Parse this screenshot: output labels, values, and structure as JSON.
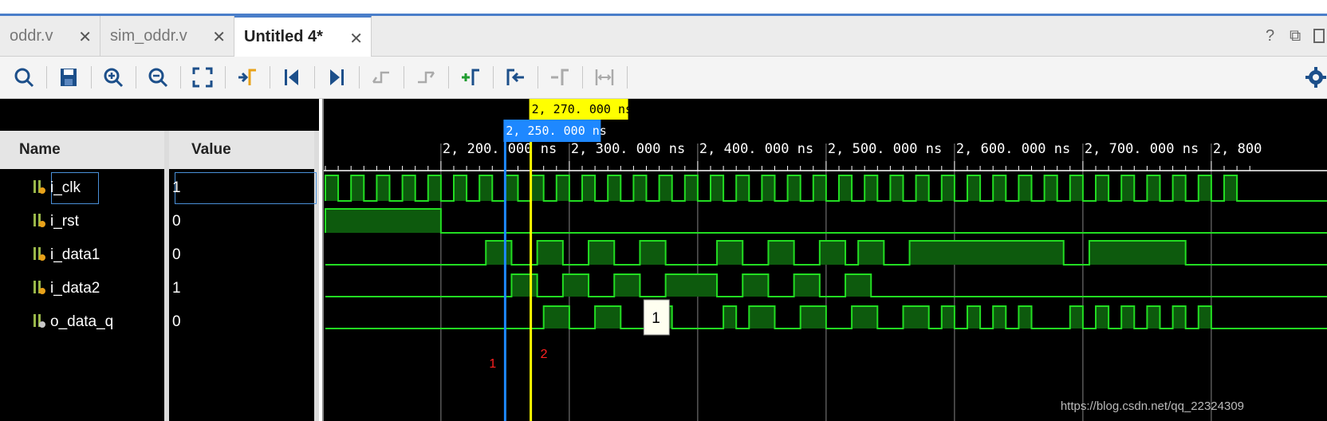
{
  "tabs": [
    {
      "label": "oddr.v",
      "active": false
    },
    {
      "label": "sim_oddr.v",
      "active": false
    },
    {
      "label": "Untitled 4*",
      "active": true
    }
  ],
  "window_controls": {
    "help": "?",
    "restore": "⧉"
  },
  "toolbar": {
    "icons": [
      "search-icon",
      "save-icon",
      "zoom-in-icon",
      "zoom-out-icon",
      "zoom-fit-icon",
      "goto-cursor-icon",
      "go-to-time-0-icon",
      "go-to-last-time-icon",
      "previous-transition-icon",
      "next-transition-icon",
      "add-marker-icon",
      "previous-marker-icon",
      "next-marker-icon",
      "swap-cursors-icon",
      "settings-icon"
    ]
  },
  "columns": {
    "name": "Name",
    "value": "Value"
  },
  "signals": [
    {
      "name": "i_clk",
      "value": "1",
      "type": "input"
    },
    {
      "name": "i_rst",
      "value": "0",
      "type": "input"
    },
    {
      "name": "i_data1",
      "value": "0",
      "type": "input"
    },
    {
      "name": "i_data2",
      "value": "1",
      "type": "input"
    },
    {
      "name": "o_data_q",
      "value": "0",
      "type": "output"
    }
  ],
  "ruler": {
    "ticks": [
      "2, 200. 000 ns",
      "2, 300. 000 ns",
      "2, 400. 000 ns",
      "2, 500. 000 ns",
      "2, 600. 000 ns",
      "2, 700. 000 ns",
      "2, 800"
    ],
    "tick_times": [
      2200,
      2300,
      2400,
      2500,
      2600,
      2700,
      2800
    ]
  },
  "cursors": {
    "main": {
      "label": "2, 270. 000 ns",
      "time": 2270,
      "color": "#ffff00"
    },
    "secondary": {
      "label": "2, 250. 000 ns",
      "time": 2250,
      "color": "#1e88ff"
    }
  },
  "markers": [
    {
      "label": "1",
      "time": 2250,
      "color": "#ff2020"
    },
    {
      "label": "2",
      "time": 2270,
      "color": "#ff2020"
    }
  ],
  "tooltip": {
    "text": "1"
  },
  "waves": {
    "clk_period_ns": 20,
    "visible_start_ns": 2110,
    "i_rst_high_until_ns": 2200,
    "i_data1_high": [
      [
        2235,
        2255
      ],
      [
        2275,
        2295
      ],
      [
        2315,
        2335
      ],
      [
        2355,
        2375
      ],
      [
        2415,
        2435
      ],
      [
        2455,
        2475
      ],
      [
        2495,
        2515
      ],
      [
        2525,
        2545
      ],
      [
        2565,
        2685
      ],
      [
        2705,
        2780
      ]
    ],
    "i_data2_high": [
      [
        2255,
        2275
      ],
      [
        2295,
        2315
      ],
      [
        2335,
        2355
      ],
      [
        2375,
        2415
      ],
      [
        2435,
        2455
      ],
      [
        2475,
        2495
      ],
      [
        2515,
        2535
      ]
    ],
    "o_data_q_high": [
      [
        2280,
        2300
      ],
      [
        2320,
        2340
      ],
      [
        2360,
        2380
      ],
      [
        2420,
        2430
      ],
      [
        2440,
        2460
      ],
      [
        2480,
        2500
      ],
      [
        2520,
        2540
      ],
      [
        2560,
        2580
      ],
      [
        2590,
        2600
      ],
      [
        2610,
        2620
      ],
      [
        2630,
        2640
      ],
      [
        2650,
        2660
      ],
      [
        2690,
        2700
      ],
      [
        2710,
        2720
      ],
      [
        2730,
        2740
      ],
      [
        2750,
        2760
      ],
      [
        2770,
        2780
      ],
      [
        2790,
        2800
      ]
    ]
  },
  "watermark": "https://blog.csdn.net/qq_22324309"
}
